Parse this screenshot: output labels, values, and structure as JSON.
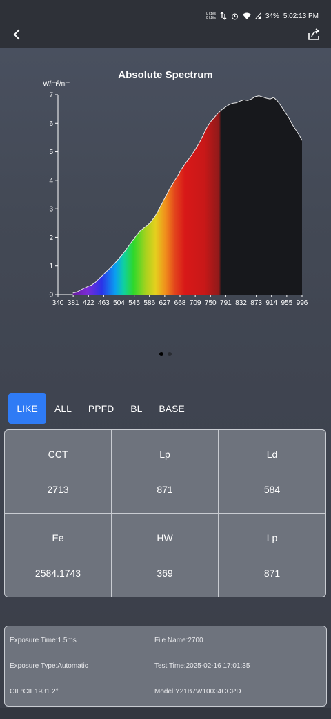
{
  "status_bar": {
    "net_up": "0 kB/s",
    "net_down": "0 kB/s",
    "battery": "34%",
    "time": "5:02:13 PM"
  },
  "topbar": {
    "back_icon": "chevron-left-icon",
    "share_icon": "share-icon"
  },
  "chart_data": {
    "type": "area",
    "title": "Absolute Spectrum",
    "ylabel": "W/m²/nm",
    "ylim": [
      0,
      7
    ],
    "xlim": [
      340,
      996
    ],
    "yticks": [
      "0",
      "1",
      "2",
      "3",
      "4",
      "5",
      "6",
      "7"
    ],
    "xticks": [
      "340",
      "381",
      "422",
      "463",
      "504",
      "545",
      "586",
      "627",
      "668",
      "709",
      "750",
      "791",
      "832",
      "873",
      "914",
      "955",
      "996"
    ],
    "x": [
      380,
      390,
      400,
      410,
      420,
      430,
      440,
      450,
      460,
      470,
      480,
      490,
      500,
      510,
      520,
      530,
      540,
      550,
      560,
      570,
      580,
      590,
      600,
      610,
      620,
      630,
      640,
      650,
      660,
      670,
      680,
      690,
      700,
      710,
      720,
      730,
      740,
      750,
      760,
      770,
      780,
      790,
      800,
      810,
      820,
      830,
      840,
      850,
      860,
      870,
      880,
      890,
      900,
      910,
      920,
      930,
      940,
      950,
      960,
      970,
      980,
      990,
      996
    ],
    "values": [
      0.05,
      0.08,
      0.15,
      0.22,
      0.28,
      0.33,
      0.42,
      0.55,
      0.67,
      0.8,
      0.92,
      1.05,
      1.2,
      1.35,
      1.52,
      1.7,
      1.88,
      2.05,
      2.22,
      2.32,
      2.42,
      2.55,
      2.72,
      2.95,
      3.2,
      3.45,
      3.7,
      3.92,
      4.12,
      4.35,
      4.55,
      4.72,
      4.9,
      5.1,
      5.32,
      5.58,
      5.85,
      6.05,
      6.2,
      6.35,
      6.47,
      6.57,
      6.65,
      6.7,
      6.72,
      6.78,
      6.82,
      6.8,
      6.85,
      6.93,
      6.96,
      6.92,
      6.88,
      6.85,
      6.9,
      6.78,
      6.6,
      6.4,
      6.2,
      5.95,
      5.75,
      5.55,
      5.4
    ]
  },
  "pager": {
    "count": 2,
    "active": 0
  },
  "tabs": [
    {
      "label": "LIKE",
      "active": true
    },
    {
      "label": "ALL",
      "active": false
    },
    {
      "label": "PPFD",
      "active": false
    },
    {
      "label": "BL",
      "active": false
    },
    {
      "label": "BASE",
      "active": false
    }
  ],
  "metrics": [
    {
      "label": "CCT",
      "value": "2713"
    },
    {
      "label": "Lp",
      "value": "871"
    },
    {
      "label": "Ld",
      "value": "584"
    },
    {
      "label": "Ee",
      "value": "2584.1743"
    },
    {
      "label": "HW",
      "value": "369"
    },
    {
      "label": "Lp",
      "value": "871"
    }
  ],
  "info": {
    "exposure_time": "Exposure Time:1.5ms",
    "file_name": "File Name:2700",
    "exposure_type": "Exposure Type:Automatic",
    "test_time": "Test Time:2025-02-16 17:01:35",
    "cie": "CIE:CIE1931 2°",
    "model": "Model:Y21B7W10034CCPD"
  },
  "colors": {
    "accent": "#2f7bf5",
    "header_bg": "#2e3138",
    "panel_bg": "#6e737d",
    "ir_fill": "#17181c"
  }
}
